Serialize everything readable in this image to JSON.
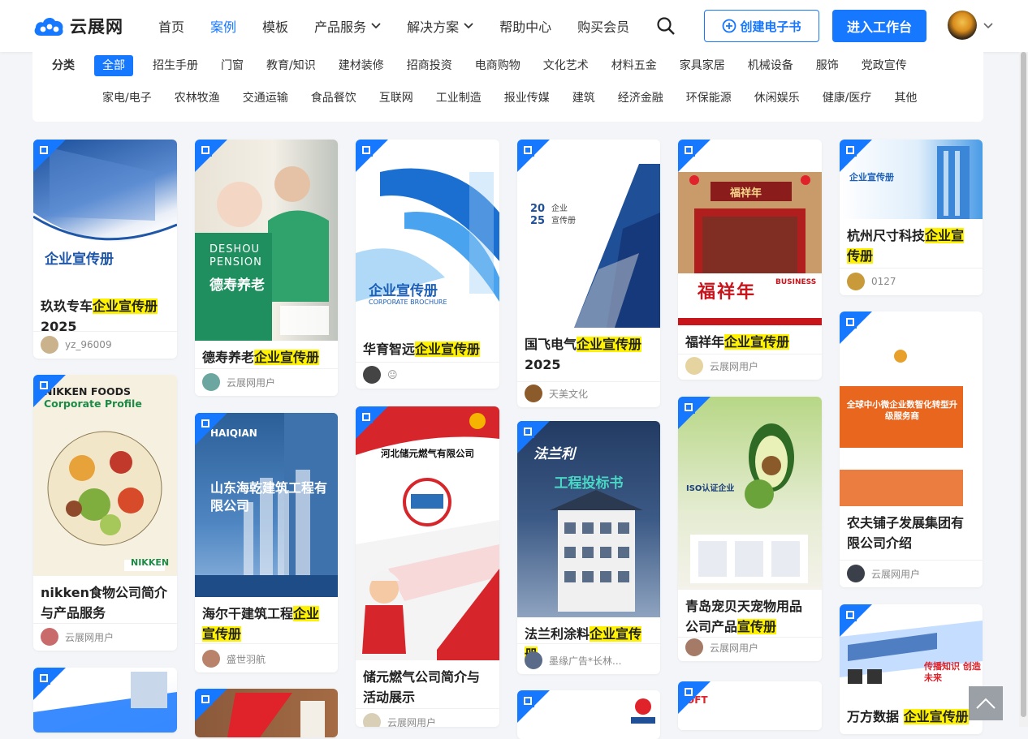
{
  "header": {
    "logo_text": "云展网",
    "nav": [
      {
        "label": "首页"
      },
      {
        "label": "案例"
      },
      {
        "label": "模板"
      },
      {
        "label": "产品服务"
      },
      {
        "label": "解决方案"
      },
      {
        "label": "帮助中心"
      },
      {
        "label": "购买会员"
      }
    ],
    "create_label": "创建电子书",
    "enter_label": "进入工作台"
  },
  "categories": {
    "label": "分类",
    "row1": [
      "全部",
      "招生手册",
      "门窗",
      "教育/知识",
      "建材装修",
      "招商投资",
      "电商购物",
      "文化艺术",
      "材料五金",
      "家具家居",
      "机械设备",
      "服饰",
      "党政宣传"
    ],
    "row2": [
      "家电/电子",
      "农林牧渔",
      "交通运输",
      "食品餐饮",
      "互联网",
      "工业制造",
      "报业传媒",
      "建筑",
      "经济金融",
      "环保能源",
      "休闲娱乐",
      "健康/医疗",
      "其他"
    ]
  },
  "cards": [
    {
      "title_pre": "玖玖专车",
      "title_hl": "企业宣传册",
      "title_post": "2025",
      "author": "yz_96009",
      "cover_text": "企业宣传册"
    },
    {
      "title_pre": "德寿养老",
      "title_hl": "企业宣传册",
      "title_post": "",
      "author": "云展网用户",
      "cover_text": "德寿养老"
    },
    {
      "title_pre": "华育智远",
      "title_hl": "企业宣传册",
      "title_post": "",
      "author": "😐",
      "cover_text": "企业宣传册"
    },
    {
      "title_pre": "国飞电气",
      "title_hl": "企业宣传册",
      "title_post": "2025",
      "author": "天美文化",
      "cover_text": "企业宣传册"
    },
    {
      "title_pre": "福祥年",
      "title_hl": "企业宣传册",
      "title_post": "",
      "author": "云展网用户",
      "cover_text": "福祥年"
    },
    {
      "title_pre": "杭州尺寸科技",
      "title_hl": "企业宣传册",
      "title_post": "",
      "author": "0127",
      "cover_text": "企业宣传册"
    },
    {
      "title_pre": "nikken食物公司简介与产品服务",
      "title_hl": "",
      "title_post": "",
      "author": "云展网用户",
      "cover_text": "NIKKEN FOODS"
    },
    {
      "title_pre": "海尔干建筑工程",
      "title_hl": "企业宣传册",
      "title_post": "",
      "author": "盛世羽航",
      "cover_text": "山东海乾建筑工程有限公司"
    },
    {
      "title_pre": "储元燃气公司简介与活动展示",
      "title_hl": "",
      "title_post": "",
      "author": "云展网用户",
      "cover_text": "河北储元燃气有限公司"
    },
    {
      "title_pre": "法兰利涂料",
      "title_hl": "企业宣传册",
      "title_post": "",
      "author": "墨缘广告*长林...",
      "cover_text": "工程投标书"
    },
    {
      "title_pre": "青岛宠贝天宠物用品公司产品",
      "title_hl": "宣传册",
      "title_post": "",
      "author": "云展网用户",
      "cover_text": "ISO认证企业"
    },
    {
      "title_pre": "农夫铺子发展集团有限公司介绍",
      "title_hl": "",
      "title_post": "",
      "author": "云展网用户",
      "cover_text": "全球中小微企业数智化转型升级服务商"
    },
    {
      "title_pre": "万方数据 ",
      "title_hl": "企业宣传册",
      "title_post": "",
      "author": "",
      "cover_text": "传播知识 创造未来"
    }
  ]
}
